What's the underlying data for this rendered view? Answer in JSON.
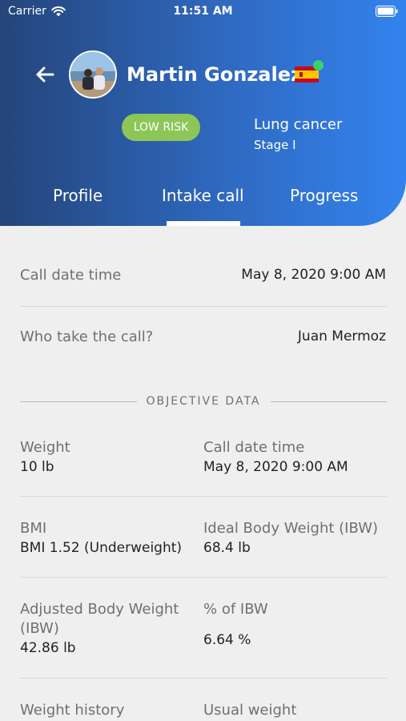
{
  "status_bar": {
    "carrier": "Carrier",
    "time": "11:51 AM"
  },
  "header": {
    "patient_name": "Martin Gonzalez",
    "risk_badge": "LOW RISK",
    "diagnosis": "Lung cancer",
    "stage": "Stage I",
    "colors": {
      "gradient_start": "#24457a",
      "gradient_end": "#3383ee",
      "risk_badge": "#8cc657",
      "online_dot": "#37d26a"
    }
  },
  "tabs": [
    {
      "label": "Profile",
      "active": false
    },
    {
      "label": "Intake call",
      "active": true
    },
    {
      "label": "Progress",
      "active": false
    }
  ],
  "call_info": {
    "call_date_label": "Call date time",
    "call_date_value": "May 8, 2020 9:00 AM",
    "who_label": "Who take the call?",
    "who_value": "Juan Mermoz"
  },
  "objective": {
    "section_title": "OBJECTIVE DATA",
    "weight_label": "Weight",
    "weight_value": "10 lb",
    "call_date_label": "Call date time",
    "call_date_value": "May 8, 2020 9:00 AM",
    "bmi_label": "BMI",
    "bmi_value": "BMI 1.52 (Underweight)",
    "ibw_label": "Ideal Body Weight (IBW)",
    "ibw_value": "68.4 lb",
    "adjusted_label_line1": "Adjusted Body Weight",
    "adjusted_label_line2": "(IBW)",
    "adjusted_value": "42.86 lb",
    "pct_ibw_label": "% of IBW",
    "pct_ibw_value": "6.64 %",
    "weight_history_label": "Weight history",
    "usual_weight_label": "Usual weight"
  }
}
